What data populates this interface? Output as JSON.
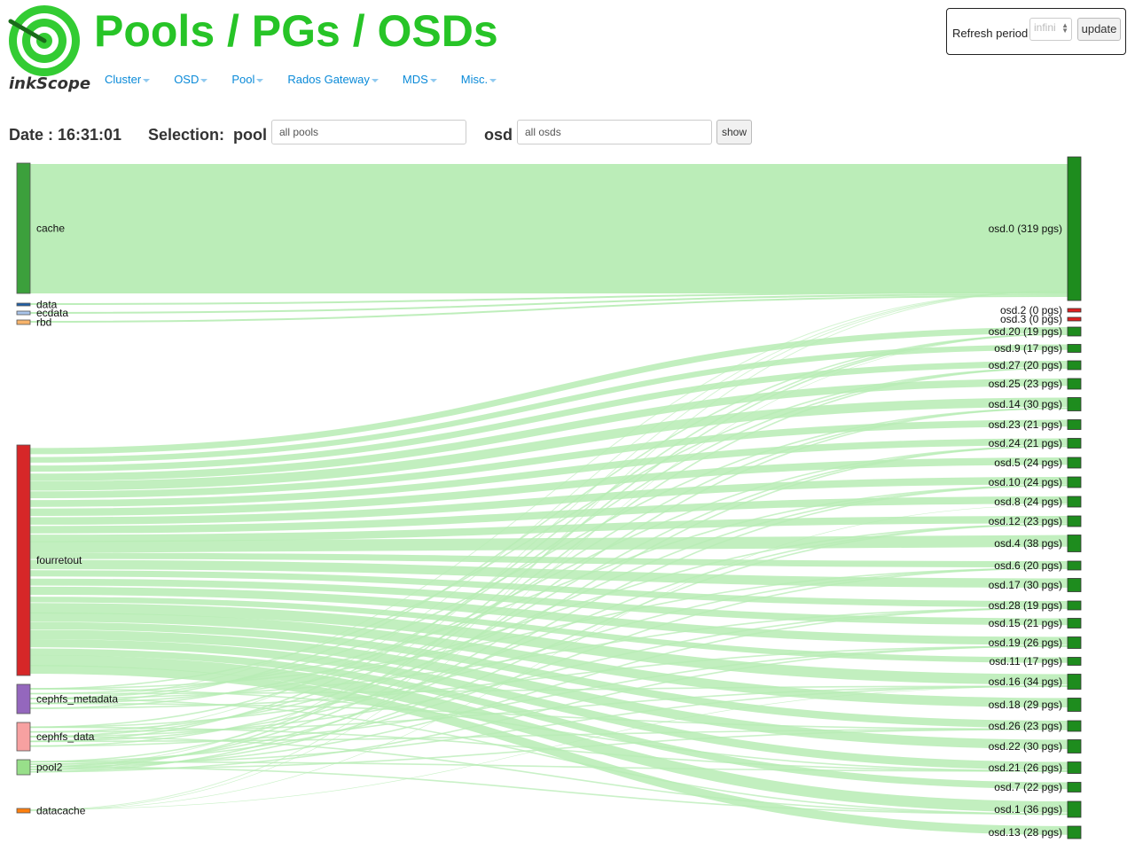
{
  "header": {
    "logo_text": "inkScope",
    "title": "Pools / PGs / OSDs"
  },
  "nav": [
    {
      "label": "Cluster"
    },
    {
      "label": "OSD"
    },
    {
      "label": "Pool"
    },
    {
      "label": "Rados Gateway"
    },
    {
      "label": "MDS"
    },
    {
      "label": "Misc."
    }
  ],
  "refresh": {
    "label": "Refresh period",
    "value": "infini",
    "button": "update"
  },
  "toolbar": {
    "date": "Date : 16:31:01",
    "selection_label": "Selection:  pool",
    "pool_input": "all pools",
    "osd_label": "osd",
    "osd_input": "all osds",
    "show_button": "show"
  },
  "colors": {
    "brand_green": "#27c427",
    "link_flow": "#b7ecb4",
    "osd_ok": "#1e8c1e",
    "osd_empty": "#e02020"
  },
  "pools": [
    {
      "name": "cache",
      "color": "#3ca03c"
    },
    {
      "name": "data",
      "color": "#1f5fa8"
    },
    {
      "name": "ecdata",
      "color": "#a9c4ea"
    },
    {
      "name": "rbd",
      "color": "#f7b36b"
    },
    {
      "name": "fourretout",
      "color": "#d62728"
    },
    {
      "name": "cephfs_metadata",
      "color": "#9467bd"
    },
    {
      "name": "cephfs_data",
      "color": "#f7a1a1"
    },
    {
      "name": "pool2",
      "color": "#98df8a"
    },
    {
      "name": "datacache",
      "color": "#ff7f0e"
    }
  ],
  "osds": [
    {
      "label": "osd.0 (319 pgs)",
      "pgs": 319
    },
    {
      "label": "osd.2 (0 pgs)",
      "pgs": 0
    },
    {
      "label": "osd.3 (0 pgs)",
      "pgs": 0
    },
    {
      "label": "osd.20 (19 pgs)",
      "pgs": 19
    },
    {
      "label": "osd.9 (17 pgs)",
      "pgs": 17
    },
    {
      "label": "osd.27 (20 pgs)",
      "pgs": 20
    },
    {
      "label": "osd.25 (23 pgs)",
      "pgs": 23
    },
    {
      "label": "osd.14 (30 pgs)",
      "pgs": 30
    },
    {
      "label": "osd.23 (21 pgs)",
      "pgs": 21
    },
    {
      "label": "osd.24 (21 pgs)",
      "pgs": 21
    },
    {
      "label": "osd.5 (24 pgs)",
      "pgs": 24
    },
    {
      "label": "osd.10 (24 pgs)",
      "pgs": 24
    },
    {
      "label": "osd.8 (24 pgs)",
      "pgs": 24
    },
    {
      "label": "osd.12 (23 pgs)",
      "pgs": 23
    },
    {
      "label": "osd.4 (38 pgs)",
      "pgs": 38
    },
    {
      "label": "osd.6 (20 pgs)",
      "pgs": 20
    },
    {
      "label": "osd.17 (30 pgs)",
      "pgs": 30
    },
    {
      "label": "osd.28 (19 pgs)",
      "pgs": 19
    },
    {
      "label": "osd.15 (21 pgs)",
      "pgs": 21
    },
    {
      "label": "osd.19 (26 pgs)",
      "pgs": 26
    },
    {
      "label": "osd.11 (17 pgs)",
      "pgs": 17
    },
    {
      "label": "osd.16 (34 pgs)",
      "pgs": 34
    },
    {
      "label": "osd.18 (29 pgs)",
      "pgs": 29
    },
    {
      "label": "osd.26 (23 pgs)",
      "pgs": 23
    },
    {
      "label": "osd.22 (30 pgs)",
      "pgs": 30
    },
    {
      "label": "osd.21 (26 pgs)",
      "pgs": 26
    },
    {
      "label": "osd.7 (22 pgs)",
      "pgs": 22
    },
    {
      "label": "osd.1 (36 pgs)",
      "pgs": 36
    },
    {
      "label": "osd.13 (28 pgs)",
      "pgs": 28
    }
  ]
}
